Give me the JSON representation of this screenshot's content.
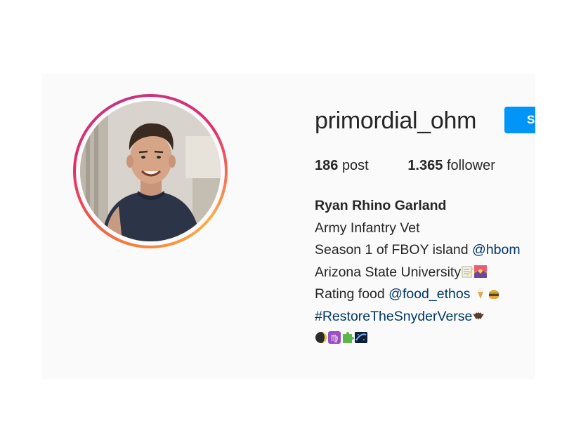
{
  "profile": {
    "username": "primordial_ohm",
    "follow_label": "S",
    "stats": {
      "posts_count": "186",
      "posts_label": "post",
      "followers_count": "1.365",
      "followers_label": "follower"
    },
    "bio": {
      "full_name": "Ryan Rhino Garland",
      "line1": "Army Infantry Vet",
      "line2_text": "Season 1 of FBOY island ",
      "line2_mention": "@hbom",
      "line3_text": "Arizona State University",
      "line4_text": "Rating food ",
      "line4_mention": "@food_ethos",
      "line5_hashtag": "#RestoreTheSnyderVerse"
    },
    "emojis": {
      "line3": [
        "memo-emoji",
        "sunrise-emoji"
      ],
      "line4": [
        "ice-cream-emoji",
        "burger-emoji"
      ],
      "line5": [
        "bat-emoji"
      ],
      "line6": [
        "moon-emoji",
        "virgo-emoji",
        "puzzle-emoji",
        "galaxy-emoji"
      ]
    }
  },
  "colors": {
    "accent_blue": "#0095f6",
    "link_blue": "#00376b",
    "text": "#262626",
    "panel_bg": "#fafafa"
  }
}
